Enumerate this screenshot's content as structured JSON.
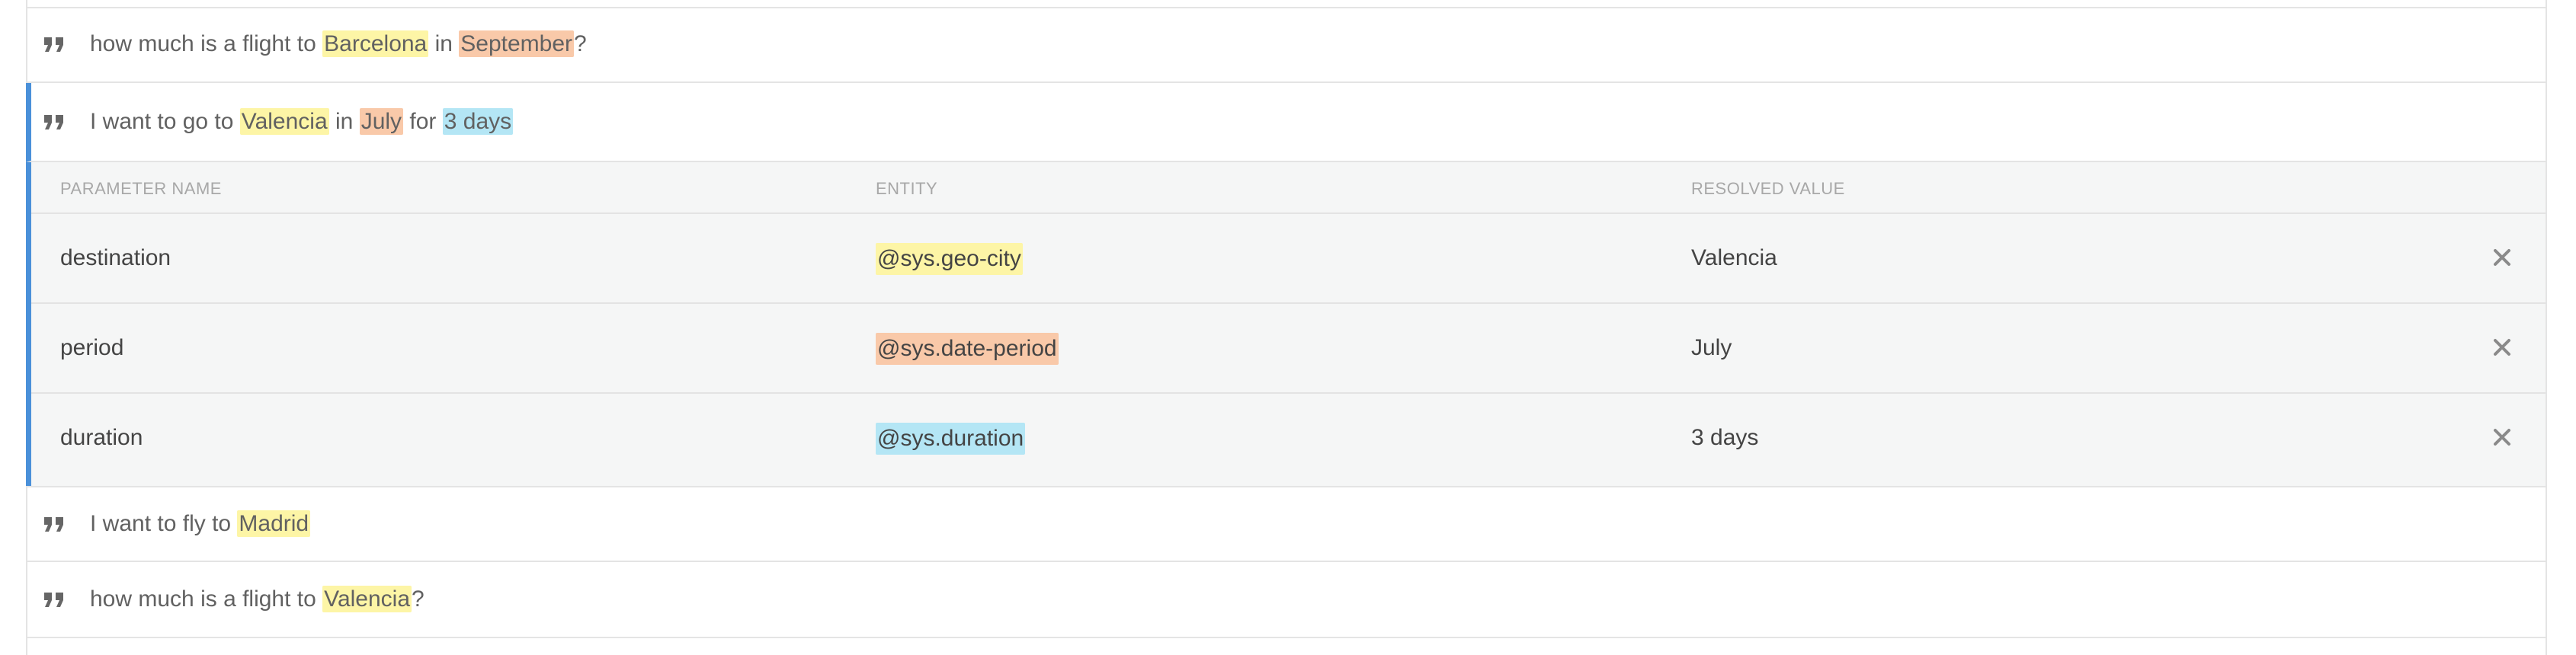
{
  "phrases": [
    {
      "parts": [
        {
          "text": "how much is a flight to ",
          "hl": ""
        },
        {
          "text": "Barcelona",
          "hl": "yellow"
        },
        {
          "text": " in ",
          "hl": ""
        },
        {
          "text": "September",
          "hl": "orange"
        },
        {
          "text": "?",
          "hl": ""
        }
      ]
    },
    {
      "parts": [
        {
          "text": "I want to go to ",
          "hl": ""
        },
        {
          "text": "Valencia",
          "hl": "yellow"
        },
        {
          "text": " in ",
          "hl": ""
        },
        {
          "text": "July",
          "hl": "orange"
        },
        {
          "text": " for ",
          "hl": ""
        },
        {
          "text": "3 days",
          "hl": "blue"
        }
      ]
    },
    {
      "parts": [
        {
          "text": "I want to fly to ",
          "hl": ""
        },
        {
          "text": "Madrid",
          "hl": "yellow"
        }
      ]
    },
    {
      "parts": [
        {
          "text": "how much is a flight to ",
          "hl": ""
        },
        {
          "text": "Valencia",
          "hl": "yellow"
        },
        {
          "text": "?",
          "hl": ""
        }
      ]
    }
  ],
  "params_table": {
    "headers": {
      "name": "PARAMETER NAME",
      "entity": "ENTITY",
      "value": "RESOLVED VALUE"
    },
    "rows": [
      {
        "name": "destination",
        "entity": "@sys.geo-city",
        "entity_hl": "yellow",
        "value": "Valencia"
      },
      {
        "name": "period",
        "entity": "@sys.date-period",
        "entity_hl": "orange",
        "value": "July"
      },
      {
        "name": "duration",
        "entity": "@sys.duration",
        "entity_hl": "blue",
        "value": "3 days"
      }
    ]
  },
  "icons": {
    "quote": "quote-icon",
    "remove": "close-icon"
  },
  "colors": {
    "accent": "#4a90d9",
    "highlight_yellow": "#fdf5a6",
    "highlight_orange": "#f9c9a9",
    "highlight_blue": "#b4e6f5"
  }
}
